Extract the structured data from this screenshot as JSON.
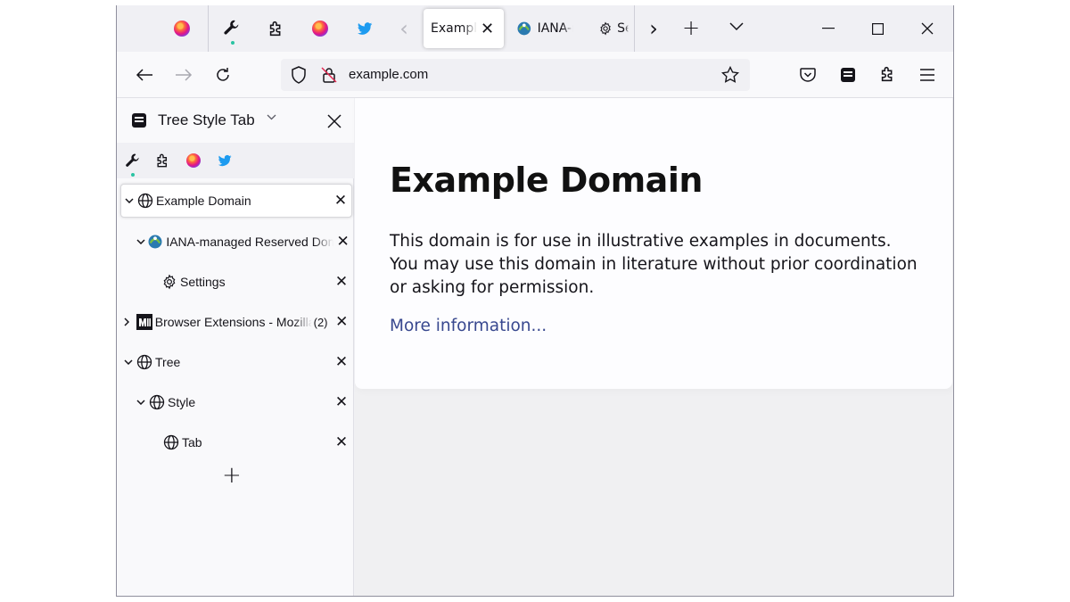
{
  "browser": {
    "tabs": [
      {
        "label": "Example Domain",
        "active": true
      },
      {
        "label": "IANA-managed Reserved Domains",
        "active": false
      },
      {
        "label": "Settings",
        "active": false
      }
    ],
    "tab_close_glyph": "✕",
    "scroll_left_glyph": "‹",
    "scroll_right_glyph": "›",
    "new_tab_glyph": "+",
    "list_all_tabs_glyph": "⌄",
    "window_controls": {
      "minimize": "—",
      "maximize": "☐",
      "close": "✕"
    }
  },
  "navbar": {
    "back_glyph": "←",
    "forward_glyph": "→",
    "reload_glyph": "↻",
    "url": "example.com",
    "menu_glyph": "≡"
  },
  "sidebar": {
    "title": "Tree Style Tab",
    "title_chevron": "⌄",
    "close_glyph": "✕",
    "tree": [
      {
        "label": "Example Domain",
        "twisty": "⌄",
        "favicon": "globe-icon",
        "active": true,
        "depth": 0
      },
      {
        "label": "IANA-managed Reserved Domains",
        "twisty": "⌄",
        "favicon": "iana-logo-icon",
        "active": false,
        "depth": 1
      },
      {
        "label": "Settings",
        "twisty": "",
        "favicon": "gear-icon",
        "active": false,
        "depth": 2
      },
      {
        "label": "Browser Extensions - Mozilla",
        "twisty": "›",
        "favicon": "mozilla-logo-icon",
        "active": false,
        "depth": 0,
        "count": "(2)"
      },
      {
        "label": "Tree",
        "twisty": "⌄",
        "favicon": "globe-icon",
        "active": false,
        "depth": 0
      },
      {
        "label": "Style",
        "twisty": "⌄",
        "favicon": "globe-icon",
        "active": false,
        "depth": 1
      },
      {
        "label": "Tab",
        "twisty": "",
        "favicon": "globe-icon",
        "active": false,
        "depth": 2
      }
    ],
    "row_close_glyph": "✕",
    "new_tab_glyph": "+"
  },
  "page": {
    "heading": "Example Domain",
    "description": "This domain is for use in illustrative examples in documents. You may use this domain in literature without prior coordination or asking for permission.",
    "link_text": "More information..."
  },
  "colors": {
    "link": "#38488f",
    "accent_green": "#2ac3a2",
    "twitter_blue": "#1d9bf0",
    "chrome": "#f0f0f4"
  }
}
